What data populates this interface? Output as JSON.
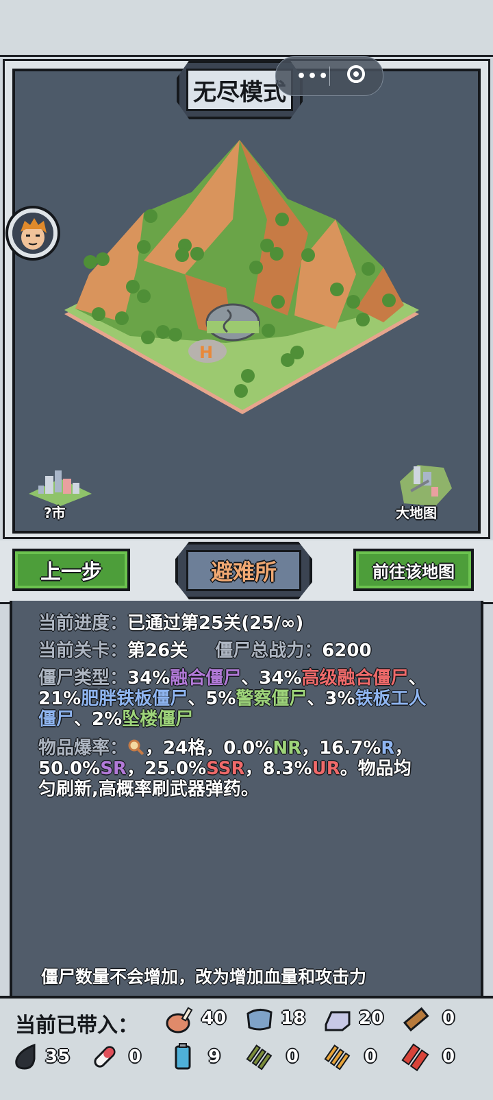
{
  "map": {
    "mode_title": "无尽模式",
    "prev_city_label": "?市",
    "world_map_label": "大地图"
  },
  "nav": {
    "prev_label": "上一步",
    "location_name": "避难所",
    "goto_label": "前往该地图"
  },
  "info": {
    "progress_label": "当前进度：",
    "progress_value": "已通过第25关(25/∞)",
    "level_label": "当前关卡：",
    "level_value": "第26关",
    "power_label": "僵尸总战力：",
    "power_value": "6200",
    "types_label": "僵尸类型：",
    "type_1_pct": "34%",
    "type_1_name": "融合僵尸",
    "type_2_pct": "、34%",
    "type_2_name": "高级融合僵尸",
    "type_3_pct": "、21%",
    "type_3_name": "肥胖铁板僵尸",
    "type_4_pct": "、5%",
    "type_4_name": "警察僵尸",
    "type_5_pct": "、3%",
    "type_5_name": "铁板工人僵尸",
    "type_6_pct": "、2%",
    "type_6_name": "坠楼僵尸",
    "drop_label": "物品爆率：",
    "drop_slots": "，24格，0.0%",
    "nr": "NR",
    "r_pct": "，16.7%",
    "r": "R",
    "r_tail": "，",
    "sr_pct": "50.0%",
    "sr": "SR",
    "ssr_pct": "，25.0%",
    "ssr": "SSR",
    "ur_pct": "，8.3%",
    "ur": "UR",
    "ur_tail": "。物品均",
    "refresh_note": "匀刷新,高概率刷武器弹药。",
    "footer_note": "僵尸数量不会增加，改为增加血量和攻击力"
  },
  "inventory": {
    "label": "当前已带入：",
    "items": [
      {
        "icon": "meat-icon",
        "count": "40"
      },
      {
        "icon": "cloth-icon",
        "count": "18"
      },
      {
        "icon": "iron-ingot-icon",
        "count": "20"
      },
      {
        "icon": "wood-plank-icon",
        "count": "0"
      },
      {
        "icon": "oil-drop-icon",
        "count": "35"
      },
      {
        "icon": "pill-icon",
        "count": "0"
      },
      {
        "icon": "battery-icon",
        "count": "9"
      },
      {
        "icon": "rifle-ammo-icon",
        "count": "0"
      },
      {
        "icon": "bullets-icon",
        "count": "0"
      },
      {
        "icon": "shotgun-shells-icon",
        "count": "0"
      }
    ]
  },
  "colors": {
    "map_bg": "#4d5a69",
    "button_green": "#4d9e3a",
    "rarity_purple": "#b27ad8",
    "rarity_red": "#ef6a6a",
    "rarity_blue": "#8fb5f0",
    "rarity_green": "#9ed47a"
  }
}
